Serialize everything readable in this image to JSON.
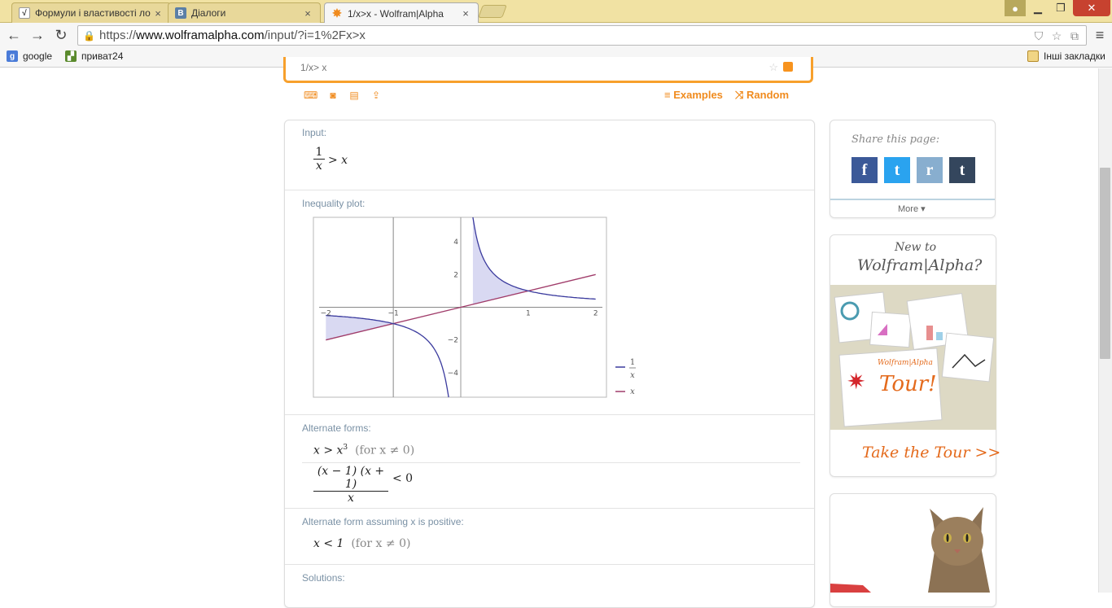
{
  "browser": {
    "tabs": [
      {
        "title": "Формули і властивості ло",
        "favicon": "formula-favicon"
      },
      {
        "title": "Діалоги",
        "favicon": "vk-favicon"
      },
      {
        "title": "1/x>x - Wolfram|Alpha",
        "favicon": "wolfram-favicon"
      }
    ],
    "url_prefix": "https://",
    "url_domain": "www.wolframalpha.com",
    "url_path": "/input/?i=1%2Fx>x",
    "bookmarks": [
      {
        "label": "google"
      },
      {
        "label": "приват24"
      }
    ],
    "other_bookmarks": "Інші закладки"
  },
  "search": {
    "query": "1/x> x",
    "examples_label": "Examples",
    "random_label": "Random"
  },
  "pods": {
    "input_title": "Input:",
    "plot_title": "Inequality plot:",
    "alternate_title": "Alternate forms:",
    "alternate_positive_title": "Alternate form assuming x is positive:",
    "solutions_title": "Solutions:"
  },
  "math": {
    "input_num": "1",
    "input_den": "x",
    "input_rest": "> x",
    "alt1": "x > x",
    "alt1_exp": "3",
    "alt1_cond": "(for x ≠ 0)",
    "alt2_num": "(x − 1) (x + 1)",
    "alt2_den": "x",
    "alt2_rest": "< 0",
    "pos1": "x < 1",
    "pos1_cond": "(for x ≠ 0)"
  },
  "chart_data": {
    "type": "line",
    "title": "",
    "xlabel": "",
    "ylabel": "",
    "xlim": [
      -2.1,
      2.1
    ],
    "ylim": [
      -5.5,
      5.5
    ],
    "x_ticks": [
      "−2",
      "−1",
      "1",
      "2"
    ],
    "y_ticks": [
      "4",
      "2",
      "−2",
      "−4"
    ],
    "series": [
      {
        "name": "1/x",
        "color": "#3b3b9e",
        "formula": "1/x"
      },
      {
        "name": "x",
        "color": "#a03c6a",
        "formula": "x"
      }
    ],
    "shaded_regions": [
      {
        "x_from": -2,
        "x_to": -1,
        "between": [
          "x",
          "1/x"
        ]
      },
      {
        "x_from": 0,
        "x_to": 1,
        "between": [
          "x",
          "1/x"
        ]
      }
    ],
    "legend_position": "bottom-right",
    "legend": [
      {
        "num": "1",
        "den": "x"
      },
      {
        "label": "x"
      }
    ]
  },
  "sidebar": {
    "share_title": "Share this page:",
    "share_buttons": [
      {
        "glyph": "f",
        "color": "#3b5998",
        "icon": "facebook-icon"
      },
      {
        "glyph": "t",
        "color": "#2aa3ef",
        "icon": "twitter-icon"
      },
      {
        "glyph": "r",
        "color": "#88aecf",
        "icon": "reddit-icon"
      },
      {
        "glyph": "t",
        "color": "#34465d",
        "icon": "tumblr-icon"
      }
    ],
    "more_label": "More",
    "new_to": "New to",
    "wolfram_brand": "Wolfram|Alpha?",
    "tour_brand": "Wolfram|Alpha",
    "tour_word": "Tour!",
    "take_tour": "Take the Tour >>"
  }
}
